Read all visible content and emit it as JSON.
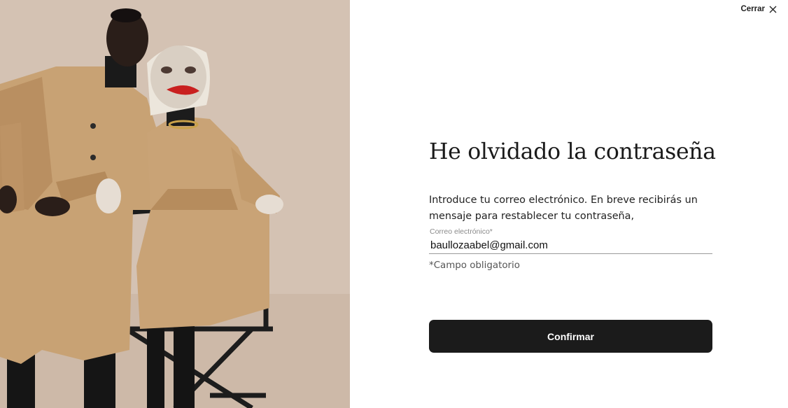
{
  "header": {
    "close_label": "Cerrar",
    "close_icon": "close-icon"
  },
  "form": {
    "title": "He olvidado la contraseña",
    "description": "Introduce tu correo electrónico. En breve recibirás un mensaje para restablecer tu contraseña,",
    "email_label": "Correo electrónico*",
    "email_value": "baullozaabel@gmail.com",
    "required_note": "*Campo obligatorio",
    "confirm_label": "Confirmar"
  },
  "colors": {
    "button_bg": "#1b1b1b",
    "photo_bg": "#d3c1b1",
    "coat": "#c49a6c"
  }
}
